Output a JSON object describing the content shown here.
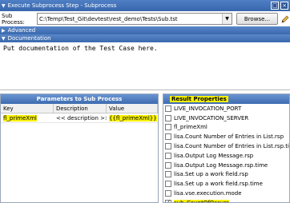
{
  "titlebar": {
    "title": "Execute Subprocess Step - Subprocess"
  },
  "subprocess": {
    "label": "Sub Process:",
    "value": "C:\\Temp\\Test_Git\\devtest\\rest_demo\\Tests\\Sub.tst",
    "browse_label": "Browse..."
  },
  "sections": {
    "advanced": "Advanced",
    "documentation": "Documentation"
  },
  "documentation_text": "Put documentation of the Test Case here.",
  "params": {
    "title": "Parameters to Sub Process",
    "columns": [
      "Key",
      "Description",
      "Value"
    ],
    "rows": [
      {
        "key": "fl_primeXml",
        "description": "<< description >>",
        "value": "{{fl_primeXml}}"
      }
    ]
  },
  "result": {
    "title": "Result Properties",
    "items": [
      {
        "label": "LIVE_INVOCATION_PORT",
        "checked": false
      },
      {
        "label": "LIVE_INVOCATION_SERVER",
        "checked": false
      },
      {
        "label": "fl_primeXml",
        "checked": false
      },
      {
        "label": "lisa.Count Number of Entries in List.rsp",
        "checked": false
      },
      {
        "label": "lisa.Count Number of Entries in List.rsp.time",
        "checked": false
      },
      {
        "label": "lisa.Output Log Message.rsp",
        "checked": false
      },
      {
        "label": "lisa.Output Log Message.rsp.time",
        "checked": false
      },
      {
        "label": "lisa.Set up a work field.rsp",
        "checked": false
      },
      {
        "label": "lisa.Set up a work field.rsp.time",
        "checked": false
      },
      {
        "label": "lisa.vse.execution.mode",
        "checked": false
      },
      {
        "label": "sub_CountOfOccurs",
        "checked": true
      }
    ]
  },
  "colors": {
    "titlebar": "#3d6bb0",
    "highlight": "#f7f000"
  },
  "icons": {
    "collapse": "triangle-down-icon",
    "edit": "pencil-icon",
    "dropdown": "chevron-down-icon"
  }
}
